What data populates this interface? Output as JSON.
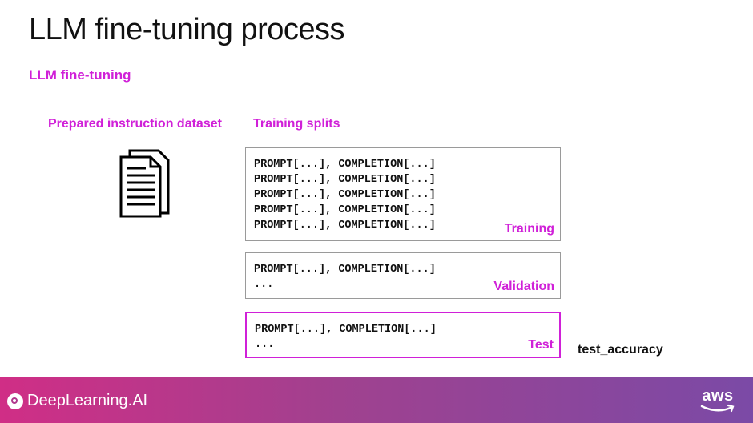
{
  "slide": {
    "title": "LLM fine-tuning process",
    "subtitle": "LLM fine-tuning",
    "dataset_heading": "Prepared instruction dataset",
    "splits_heading": "Training splits"
  },
  "splits": {
    "training": {
      "label": "Training",
      "rows": [
        "PROMPT[...], COMPLETION[...]",
        "PROMPT[...], COMPLETION[...]",
        "PROMPT[...], COMPLETION[...]",
        "PROMPT[...], COMPLETION[...]",
        "PROMPT[...], COMPLETION[...]"
      ]
    },
    "validation": {
      "label": "Validation",
      "rows": [
        "PROMPT[...], COMPLETION[...]",
        "..."
      ]
    },
    "test": {
      "label": "Test",
      "rows": [
        "PROMPT[...], COMPLETION[...]",
        "..."
      ]
    }
  },
  "test_metric": "test_accuracy",
  "footer": {
    "brand": "DeepLearning.AI",
    "partner": "aws"
  },
  "colors": {
    "accent": "#d020d8",
    "footer_start": "#d02e86",
    "footer_end": "#7b4aa6"
  },
  "icons": {
    "dataset": "documents-icon",
    "brand_logo": "deeplearning-logo-icon",
    "partner_logo": "aws-logo-icon"
  }
}
